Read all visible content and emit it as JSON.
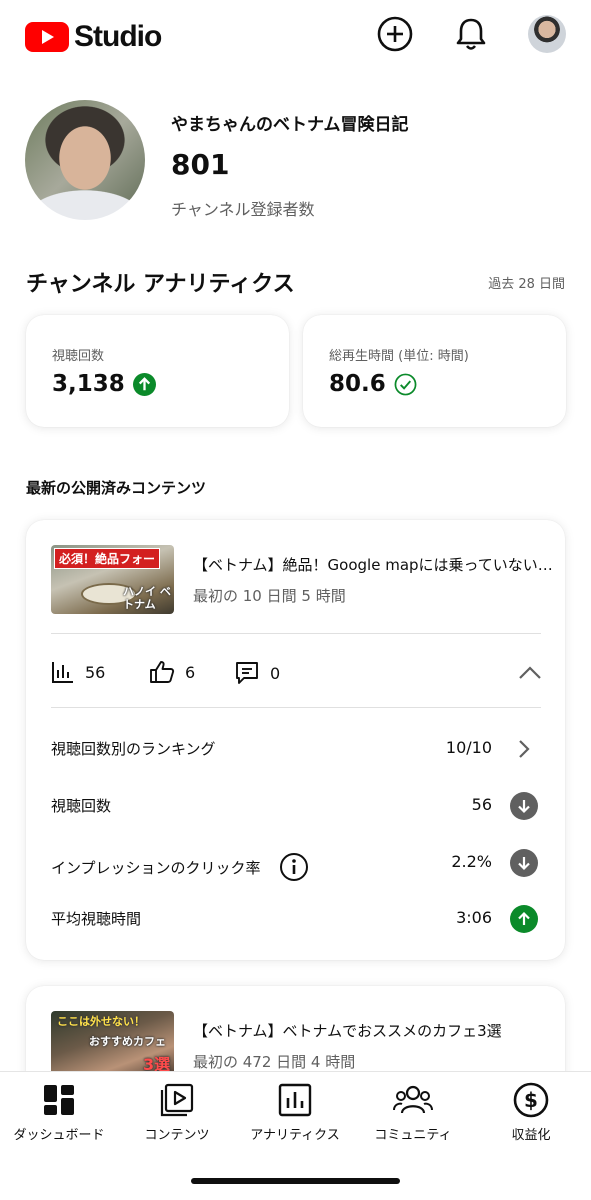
{
  "header": {
    "logo_text": "Studio",
    "icons": [
      "create-icon",
      "bell-icon",
      "account-avatar"
    ]
  },
  "channel": {
    "name": "やまちゃんのベトナム冒険日記",
    "subscribers": "801",
    "subscribers_label": "チャンネル登録者数"
  },
  "analytics": {
    "title": "チャンネル アナリティクス",
    "period": "過去 28 日間",
    "views": {
      "label": "視聴回数",
      "value": "3,138",
      "trend": "up"
    },
    "watch_time": {
      "label": "総再生時間 (単位: 時間)",
      "value": "80.6",
      "status": "check"
    }
  },
  "latest": {
    "title": "最新の公開済みコンテンツ",
    "video1": {
      "thumb_text_top": "必須！絶品フォー",
      "thumb_text_bottom": "ハノイ ベトナム",
      "title": "【ベトナム】絶品！Google mapには乗っていない穴場フォー",
      "subtitle": "最初の 10 日間 5 時間",
      "stats": {
        "views": "56",
        "likes": "6",
        "comments": "0"
      },
      "rows": [
        {
          "label": "視聴回数別のランキング",
          "value": "10/10",
          "indicator": "chevron-right"
        },
        {
          "label": "視聴回数",
          "value": "56",
          "indicator": "down"
        },
        {
          "label": "インプレッションのクリック率",
          "value": "2.2%",
          "indicator": "down"
        },
        {
          "label": "平均視聴時間",
          "value": "3:06",
          "indicator": "up"
        }
      ]
    },
    "video2": {
      "thumb_text_top": "ここは外せない！",
      "thumb_text_mid": "おすすめカフェ",
      "thumb_text_bottom": "3選",
      "title": "【ベトナム】ベトナムでおススメのカフェ3選",
      "subtitle": "最初の 472 日間 4 時間"
    }
  },
  "nav": [
    {
      "label": "ダッシュボード",
      "icon": "dashboard-icon"
    },
    {
      "label": "コンテンツ",
      "icon": "content-icon"
    },
    {
      "label": "アナリティクス",
      "icon": "analytics-icon"
    },
    {
      "label": "コミュニティ",
      "icon": "community-icon"
    },
    {
      "label": "収益化",
      "icon": "monetization-icon"
    }
  ],
  "colors": {
    "brand": "#ff0000",
    "trend_up": "#0b8a2a",
    "trend_down": "#606060",
    "muted": "#606060"
  }
}
